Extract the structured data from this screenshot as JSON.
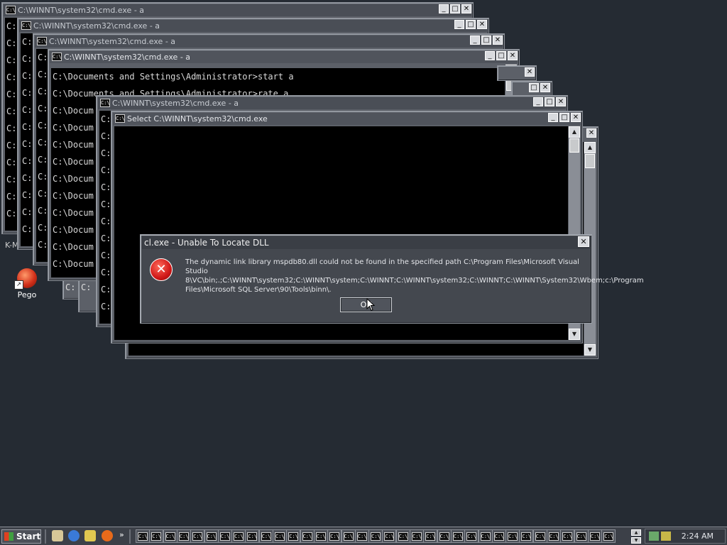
{
  "windows": [
    {
      "title": "C:\\WINNT\\system32\\cmd.exe - a",
      "lines": [
        "C:",
        "C:",
        "C:",
        "C:",
        "C:",
        "C:",
        "C:",
        "C:",
        "C:",
        "C:",
        "C:",
        "C:",
        "C:"
      ]
    },
    {
      "title": "C:\\WINNT\\system32\\cmd.exe - a",
      "lines": [
        "C:",
        "C:",
        "C:",
        "C:",
        "C:",
        "C:",
        "C:",
        "C:",
        "C:",
        "C:",
        "C:",
        "C:",
        "C:"
      ]
    },
    {
      "title": "C:\\WINNT\\system32\\cmd.exe - a",
      "lines": [
        "C:",
        "C:",
        "C:",
        "C:",
        "C:",
        "C:",
        "C:",
        "C:",
        "C:",
        "C:",
        "C:",
        "C:",
        "C:"
      ]
    },
    {
      "title": "C:\\WINNT\\system32\\cmd.exe - a",
      "lines": [
        "C:\\Documents and Settings\\Administrator>start a",
        "C:\\Documents and Settings\\Administrator>rate a",
        "C:\\Docum",
        "C:\\Docum",
        "C:\\Docum",
        "C:\\Docum",
        "C:\\Docum",
        "C:\\Docum",
        "C:\\Docum",
        "C:\\Docum",
        "C:\\Docum",
        "C:\\Docum"
      ]
    },
    {
      "title": "C:\\WINNT\\system32\\cmd.exe - a",
      "lines": [
        "C:",
        "C:",
        "C:",
        "C:",
        "C:",
        "C:",
        "C:",
        "C:",
        "C:",
        "C:",
        "C:",
        "C:"
      ]
    },
    {
      "title": "Select C:\\WINNT\\system32\\cmd.exe",
      "lines": []
    }
  ],
  "behind_fragments": [
    "C:",
    "C:"
  ],
  "side_label": "K-M",
  "desktop_icon": {
    "label": "Pego"
  },
  "dialog": {
    "title": "cl.exe - Unable To Locate DLL",
    "close": "✕",
    "icon": "error-icon",
    "message": "The dynamic link library mspdb80.dll could not be found in the specified path C:\\Program Files\\Microsoft Visual Studio 8\\VC\\bin;.;C:\\WINNT\\system32;C:\\WINNT\\system;C:\\WINNT;C:\\WINNT\\system32;C:\\WINNT;C:\\WINNT\\System32\\Wbem;c:\\Program Files\\Microsoft SQL Server\\90\\Tools\\binn\\.",
    "ok_label": "OK"
  },
  "taskbar": {
    "start_label": "Start",
    "quicklaunch_chevron": "»",
    "task_icon_text": "C:\\",
    "task_count": 35,
    "clock": "2:24 AM"
  },
  "icons": {
    "minimize": "_",
    "maximize": "□",
    "close": "✕",
    "scroll_up": "▲",
    "scroll_down": "▼",
    "sys": "C:\\"
  }
}
